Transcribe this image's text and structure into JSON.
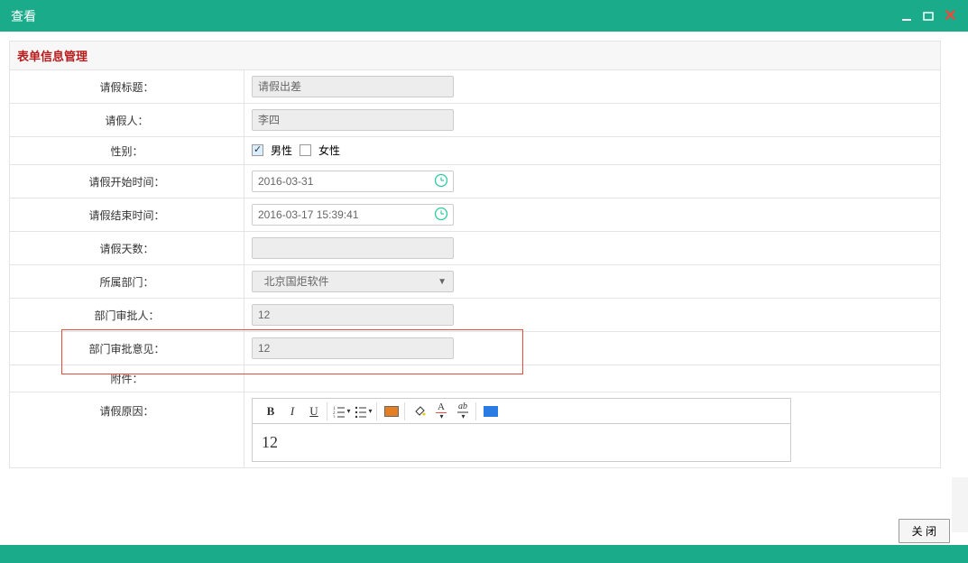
{
  "window": {
    "title": "查看"
  },
  "section": {
    "header": "表单信息管理"
  },
  "labels": {
    "title": "请假标题：",
    "person": "请假人：",
    "gender": "性别：",
    "start": "请假开始时间：",
    "end": "请假结束时间：",
    "days": "请假天数：",
    "dept": "所属部门：",
    "approver": "部门审批人：",
    "opinion": "部门审批意见：",
    "attachment": "附件：",
    "reason": "请假原因："
  },
  "values": {
    "title": "请假出差",
    "person": "李四",
    "gender_male": "男性",
    "gender_female": "女性",
    "start": "2016-03-31",
    "end": "2016-03-17 15:39:41",
    "days": "",
    "dept": "北京国炬软件",
    "approver": "12",
    "opinion": "12",
    "reason_content": "12"
  },
  "editor": {
    "btn_bold": "B",
    "btn_italic": "I",
    "btn_underline": "U",
    "btn_fontcolor": "A"
  },
  "footer": {
    "close_label": "关 闭"
  }
}
